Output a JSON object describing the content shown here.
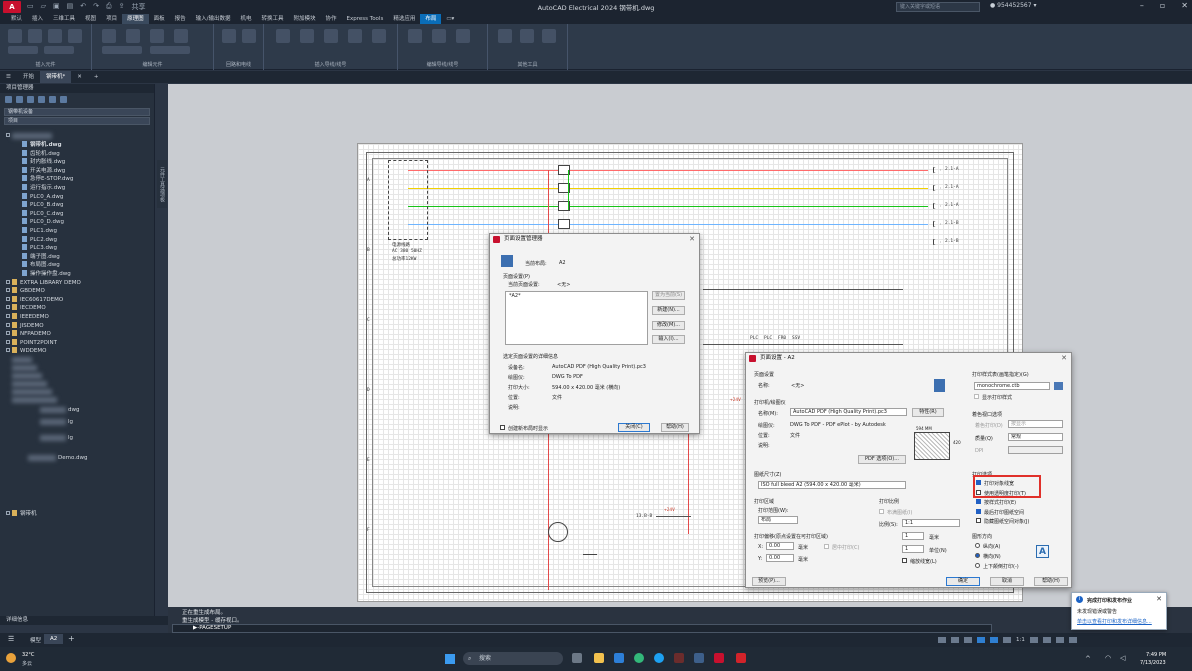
{
  "app": {
    "title": "AutoCAD Electrical 2024   钢带机.dwg",
    "logo_text": "A",
    "search_placeholder": "键入关键字或短语",
    "user": "954452567",
    "share_label": "共享"
  },
  "menu_tabs": [
    "默认",
    "插入",
    "三维工具",
    "视图",
    "项目",
    "原理图",
    "面板",
    "报告",
    "输入/输出数据",
    "机电",
    "转换工具",
    "附加模块",
    "协作",
    "Express Tools",
    "精选应用",
    "布局"
  ],
  "menu_active_index": 5,
  "menu_accent_index": 15,
  "ribbon_groups": [
    "插入元件",
    "编辑元件",
    "回路和电线",
    "插入导线/线号",
    "编辑导线/线号",
    "其他工具"
  ],
  "doc_tabs": [
    {
      "label": "开始"
    },
    {
      "label": "钢带机*",
      "active": true
    }
  ],
  "panel": {
    "title": "项目管理器",
    "select1": "钢带机设备",
    "select2": "项目",
    "files": [
      "钢带机.dwg",
      "齿轮机.dwg",
      "封内胀线.dwg",
      "开关电源.dwg",
      "急停E-STOP.dwg",
      "运行指示.dwg",
      "PLC0_A.dwg",
      "PLC0_B.dwg",
      "PLC0_C.dwg",
      "PLC0_D.dwg",
      "PLC1.dwg",
      "PLC2.dwg",
      "PLC3.dwg",
      "端子图.dwg",
      "布局图.dwg",
      "操作操作盘.dwg"
    ],
    "projects": [
      "EXTRA LIBRARY DEMO",
      "GBDEMO",
      "IEC60617DEMO",
      "IECDEMO",
      "IEEEDEMO",
      "JISDEMO",
      "NFPADEMO",
      "POINT2POINT",
      "WDDEMO"
    ],
    "partial_files": [
      "dwg",
      "lg",
      "lg",
      "Demo.dwg"
    ],
    "last_project": "钢带机",
    "side_tab": "元件工具选项板",
    "footer": "详细信息"
  },
  "sheet": {
    "left_note_lines": [
      "电源线路",
      "AC 380 50HZ",
      "总功率12KW"
    ],
    "right_labels": [
      "2.1-A",
      "2.1-A",
      "2.1-A",
      "2.1-B",
      "2.1-B"
    ],
    "plc_labels": [
      "PLC",
      "PLC",
      "FR0",
      "SSV"
    ],
    "bottom_labels": [
      "13.B-B",
      "+24V",
      "+24V"
    ],
    "row_letters": [
      "A",
      "B",
      "C",
      "D",
      "E",
      "F"
    ]
  },
  "dialog1": {
    "title": "页面设置管理器",
    "current_layout_label": "当前布局:",
    "current_layout_value": "A2",
    "section": "页面设置(P)",
    "current_setup_label": "当前页面设置:",
    "current_setup_value": "<无>",
    "list_item": "*A2*",
    "btn_set_current": "置为当前(S)",
    "btn_new": "新建(N)...",
    "btn_modify": "修改(M)...",
    "btn_import": "输入(I)...",
    "details_title": "选定页面设置的详细信息",
    "details": [
      {
        "k": "设备名:",
        "v": "AutoCAD PDF (High Quality Print).pc3"
      },
      {
        "k": "绘图仪:",
        "v": "DWG To PDF"
      },
      {
        "k": "打印大小:",
        "v": "594.00 x 420.00 毫米 (横向)"
      },
      {
        "k": "位置:",
        "v": "文件"
      },
      {
        "k": "说明:",
        "v": ""
      }
    ],
    "checkbox_label": "创建新布局时显示",
    "btn_close": "关闭(C)",
    "btn_help": "帮助(H)"
  },
  "dialog2": {
    "title": "页面设置 - A2",
    "page_setup_section": "页面设置",
    "name_label": "名称:",
    "name_value": "<无>",
    "printer_section": "打印机/绘图仪",
    "printer_name_label": "名称(M):",
    "printer_name_value": "AutoCAD PDF (High Quality Print).pc3",
    "properties_btn": "特性(R)",
    "plotter_label": "绘图仪:",
    "plotter_value": "DWG To PDF - PDF ePlot - by Autodesk",
    "where_label": "位置:",
    "where_value": "文件",
    "desc_label": "说明:",
    "pdf_btn": "PDF 选项(O)...",
    "preview_width": "594 MM",
    "preview_height": "420",
    "paper_section": "图纸尺寸(Z)",
    "paper_value": "ISO full bleed A2 (594.00 x 420.00 毫米)",
    "area_section": "打印区域",
    "area_label": "打印范围(W):",
    "area_value": "布局",
    "offset_section": "打印偏移(原点设置在可打印区域)",
    "x_label": "X:",
    "x_value": "0.00",
    "y_label": "Y:",
    "y_value": "0.00",
    "unit_mm": "毫米",
    "center_label": "居中打印(C)",
    "scale_section": "打印比例",
    "fit_label": "布满图纸(I)",
    "scale_label": "比例(S):",
    "scale_value": "1:1",
    "scale_num": "1",
    "scale_unit": "毫米",
    "scale_den": "1",
    "scale_den_unit": "单位(N)",
    "lw_scale_label": "缩放线宽(L)",
    "style_section": "打印样式表(画笔指定)(G)",
    "style_value": "monochrome.ctb",
    "show_styles_label": "显示打印样式",
    "viewport_section": "着色视口选项",
    "shade_label": "着色打印(D)",
    "shade_value": "按显示",
    "quality_label": "质量(Q)",
    "quality_value": "常规",
    "dpi_label": "DPI",
    "options_section": "打印选项",
    "options": [
      {
        "label": "打印对象线宽",
        "on": true
      },
      {
        "label": "使用透明度打印(T)",
        "on": false
      },
      {
        "label": "按样式打印(E)",
        "on": true
      },
      {
        "label": "最后打印图纸空间",
        "on": true
      },
      {
        "label": "隐藏图纸空间对象(J)",
        "on": false
      }
    ],
    "orientation_section": "图形方向",
    "orientations": [
      {
        "label": "纵向(A)",
        "on": false
      },
      {
        "label": "横向(N)",
        "on": true
      },
      {
        "label": "上下颠倒打印(-)",
        "on": false
      }
    ],
    "preview_btn": "预览(P)...",
    "ok_btn": "确定",
    "cancel_btn": "取消",
    "help_btn": "帮助(H)",
    "highlight_color": "#e0302a"
  },
  "command": {
    "history": [
      "正在重生成布局。",
      "重生成模型 - 缓存视口。"
    ],
    "current": "PAGESETUP",
    "prefix": "▶-"
  },
  "layout_tabs": [
    "模型",
    "A2"
  ],
  "layout_active_index": 1,
  "status": {
    "scale": "1:1"
  },
  "notification": {
    "title": "完成打印和发布作业",
    "line1": "未发现错误或警告",
    "link": "单击以查看打印和发布详细信息..."
  },
  "taskbar": {
    "weather_temp": "32°C",
    "weather_desc": "多云",
    "search_placeholder": "搜索",
    "time": "7:49 PM",
    "date": "7/13/2023"
  }
}
